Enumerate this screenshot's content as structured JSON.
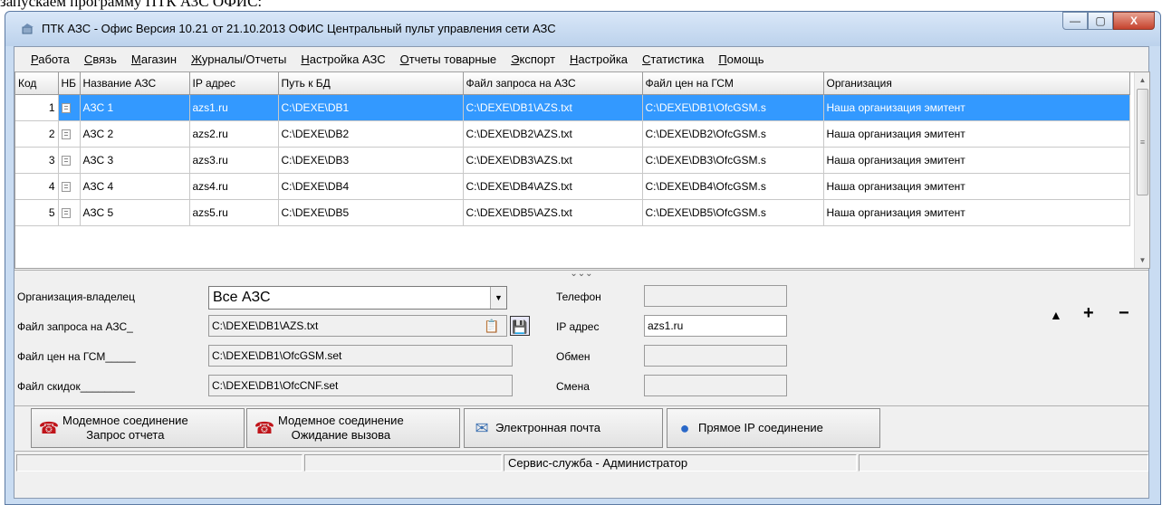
{
  "doc_text": "запускаем программу ПТК АЗС ОФИС:",
  "window": {
    "title": "ПТК АЗС - Офис Версия 10.21 от 21.10.2013 ОФИС Центральный пульт управления сети АЗС",
    "min_glyph": "—",
    "max_glyph": "▢",
    "close_glyph": "X"
  },
  "menu": [
    "Работа",
    "Связь",
    "Магазин",
    "Журналы/Отчеты",
    "Настройка АЗС",
    "Отчеты товарные",
    "Экспорт",
    "Настройка",
    "Статистика",
    "Помощь"
  ],
  "grid": {
    "columns": [
      "Код",
      "НБ",
      "Название АЗС",
      "IP адрес",
      "Путь к БД",
      "Файл запроса на АЗС",
      "Файл цен на ГСМ",
      "Организация"
    ],
    "rows": [
      {
        "code": "1",
        "name": "АЗС 1",
        "ip": "azs1.ru",
        "db": "C:\\DEXE\\DB1",
        "req": "C:\\DEXE\\DB1\\AZS.txt",
        "prices": "C:\\DEXE\\DB1\\OfcGSM.s",
        "org": "Наша организация эмитент"
      },
      {
        "code": "2",
        "name": "АЗС 2",
        "ip": "azs2.ru",
        "db": "C:\\DEXE\\DB2",
        "req": "C:\\DEXE\\DB2\\AZS.txt",
        "prices": "C:\\DEXE\\DB2\\OfcGSM.s",
        "org": "Наша организация эмитент"
      },
      {
        "code": "3",
        "name": "АЗС 3",
        "ip": "azs3.ru",
        "db": "C:\\DEXE\\DB3",
        "req": "C:\\DEXE\\DB3\\AZS.txt",
        "prices": "C:\\DEXE\\DB3\\OfcGSM.s",
        "org": "Наша организация эмитент"
      },
      {
        "code": "4",
        "name": "АЗС 4",
        "ip": "azs4.ru",
        "db": "C:\\DEXE\\DB4",
        "req": "C:\\DEXE\\DB4\\AZS.txt",
        "prices": "C:\\DEXE\\DB4\\OfcGSM.s",
        "org": "Наша организация эмитент"
      },
      {
        "code": "5",
        "name": "АЗС 5",
        "ip": "azs5.ru",
        "db": "C:\\DEXE\\DB5",
        "req": "C:\\DEXE\\DB5\\AZS.txt",
        "prices": "C:\\DEXE\\DB5\\OfcGSM.s",
        "org": "Наша организация эмитент"
      }
    ],
    "selected_index": 0
  },
  "form": {
    "owner_label": "Организация-владелец",
    "owner_value": "Все АЗС",
    "request_label": "Файл запроса на АЗС_",
    "request_value": "C:\\DEXE\\DB1\\AZS.txt",
    "prices_label": "Файл цен на ГСМ_____",
    "prices_value": "C:\\DEXE\\DB1\\OfcGSM.set",
    "discount_label": "Файл скидок_________",
    "discount_value": "C:\\DEXE\\DB1\\OfcCNF.set",
    "phone_label": "Телефон",
    "phone_value": "",
    "ip_label": "IP адрес",
    "ip_value": "azs1.ru",
    "exchange_label": "Обмен",
    "exchange_value": "",
    "shift_label": "Смена",
    "shift_value": ""
  },
  "nav": {
    "up": "▲",
    "add": "+",
    "remove": "−"
  },
  "buttons": {
    "modem_request_l1": "Модемное соединение",
    "modem_request_l2": "Запрос отчета",
    "modem_wait_l1": "Модемное соединение",
    "modem_wait_l2": "Ожидание вызова",
    "email": "Электронная почта",
    "direct_ip": "Прямое IP соединение"
  },
  "status": {
    "service": "Сервис-служба - Администратор"
  }
}
